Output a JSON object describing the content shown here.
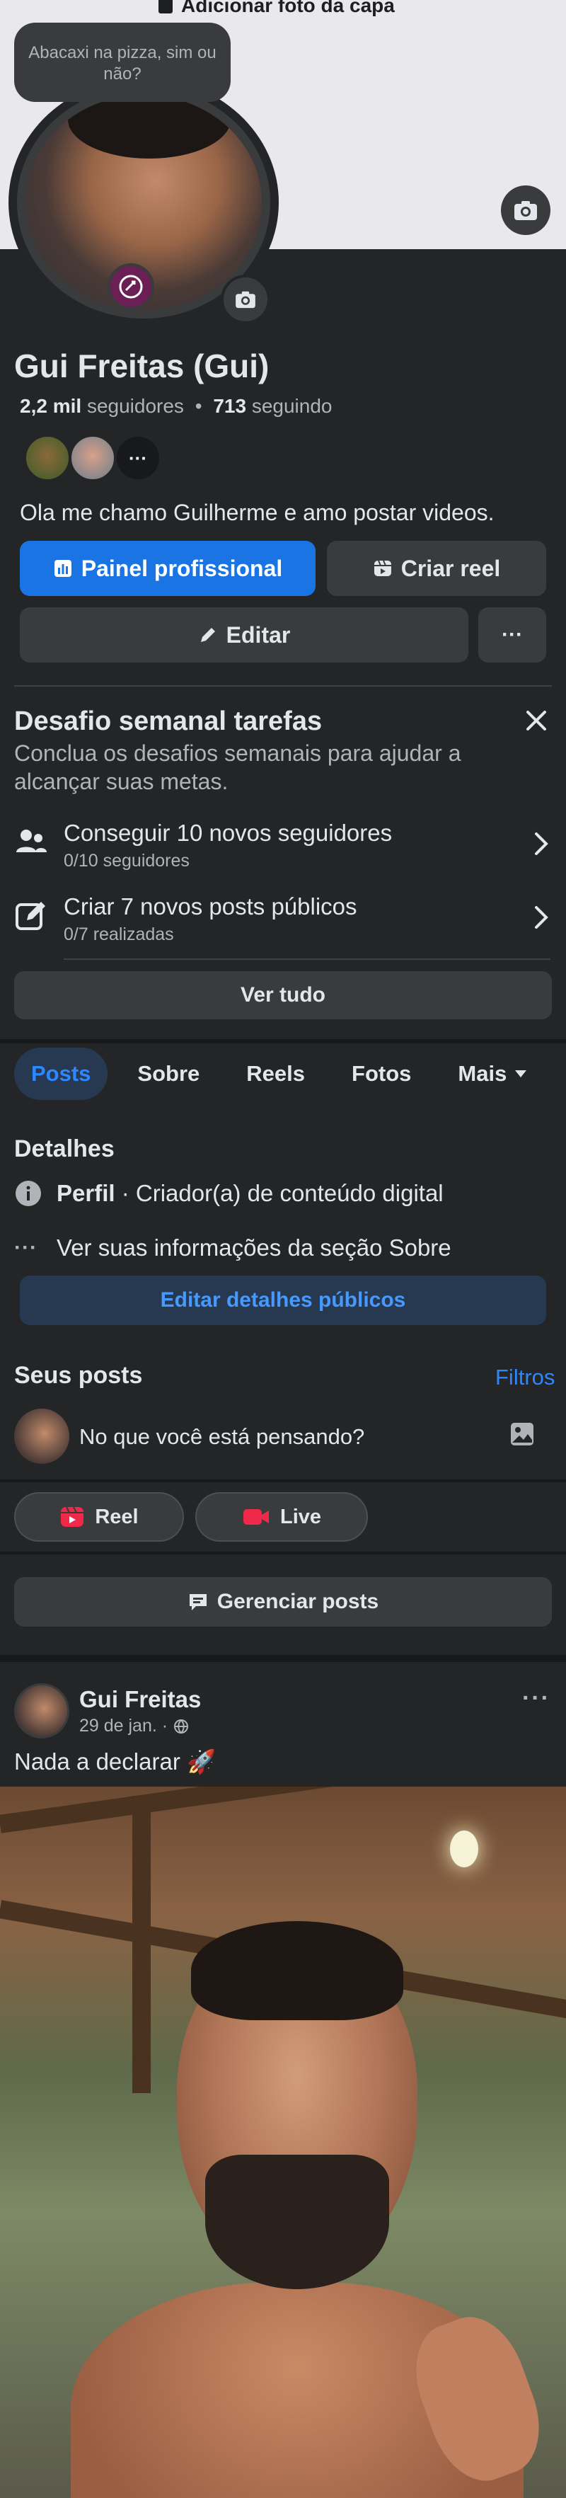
{
  "cover": {
    "add_cover_label": "Adicionar foto da capa"
  },
  "tooltip": {
    "text": "Abacaxi na pizza, sim ou não?"
  },
  "profile": {
    "name": "Gui Freitas (Gui)",
    "followers_count": "2,2 mil",
    "followers_label": "seguidores",
    "separator": "•",
    "following_count": "713",
    "following_label": "seguindo",
    "friends_more": "···",
    "bio": "Ola me chamo Guilherme e amo postar videos."
  },
  "actions": {
    "dashboard_label": "Painel profissional",
    "create_reel_label": "Criar reel",
    "edit_label": "Editar",
    "more_label": "···"
  },
  "challenge": {
    "title": "Desafio semanal tarefas",
    "subtitle": "Conclua os desafios semanais para ajudar a alcançar suas metas.",
    "tasks": [
      {
        "title": "Conseguir 10 novos seguidores",
        "progress": "0/10 seguidores"
      },
      {
        "title": "Criar 7 novos posts públicos",
        "progress": "0/7 realizadas"
      }
    ],
    "see_all_label": "Ver tudo"
  },
  "tabs": [
    {
      "label": "Posts"
    },
    {
      "label": "Sobre"
    },
    {
      "label": "Reels"
    },
    {
      "label": "Fotos"
    },
    {
      "label": "Mais"
    }
  ],
  "details": {
    "title": "Detalhes",
    "profile_label": "Perfil",
    "profile_value": " · Criador(a) de conteúdo digital",
    "about_label": "Ver suas informações da seção Sobre",
    "edit_public_label": "Editar detalhes públicos"
  },
  "posts_section": {
    "title": "Seus posts",
    "filters_label": "Filtros",
    "composer_placeholder": "No que você está pensando?",
    "reel_label": "Reel",
    "live_label": "Live",
    "manage_label": "Gerenciar posts"
  },
  "post": {
    "author": "Gui Freitas",
    "date": "29 de jan. ·",
    "more_label": "···",
    "text": "Nada a declarar 🚀"
  },
  "colors": {
    "background": "#242527",
    "card": "#3a3b3c",
    "primary_blue": "#1b74e4",
    "link_blue": "#2d88ff",
    "text_primary": "#e4e6eb",
    "text_secondary": "#b0b3b8",
    "live_red": "#f02849"
  }
}
